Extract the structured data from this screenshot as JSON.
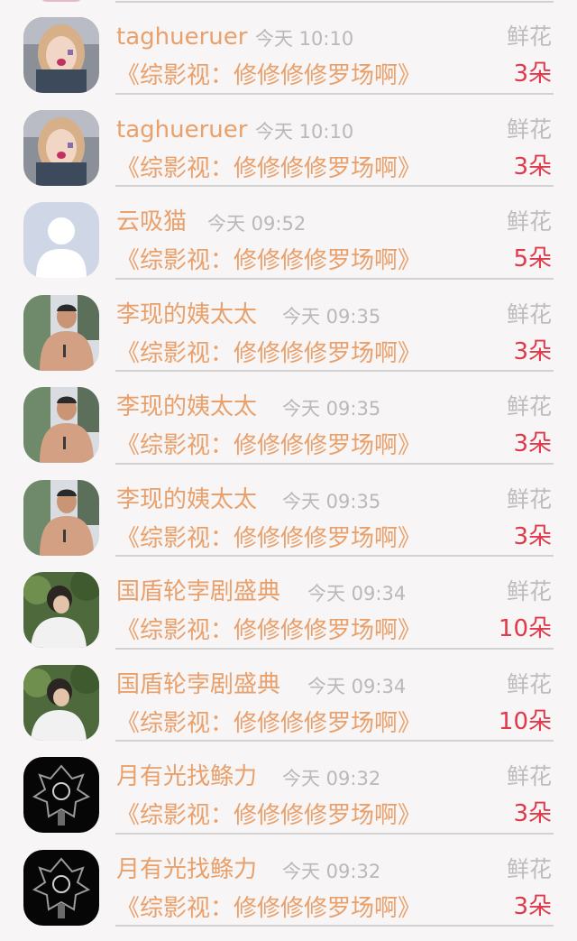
{
  "gift_type": "鲜花",
  "work_title": "《综影视：修修修修罗场啊》",
  "rows": [
    {
      "name": "taghueruer",
      "time": "今天 10:10",
      "count": "3朵",
      "avatar": "girl-avatar-icon"
    },
    {
      "name": "taghueruer",
      "time": "今天 10:10",
      "count": "3朵",
      "avatar": "girl-avatar-icon"
    },
    {
      "name": "云吸猫",
      "time": "今天 09:52",
      "count": "5朵",
      "avatar": "default-avatar-icon"
    },
    {
      "name": "李现的姨太太",
      "time": "今天 09:35",
      "count": "3朵",
      "avatar": "man-avatar-icon"
    },
    {
      "name": "李现的姨太太",
      "time": "今天 09:35",
      "count": "3朵",
      "avatar": "man-avatar-icon"
    },
    {
      "name": "李现的姨太太",
      "time": "今天 09:35",
      "count": "3朵",
      "avatar": "man-avatar-icon"
    },
    {
      "name": "国盾轮孛剧盛典",
      "time": "今天 09:34",
      "count": "10朵",
      "avatar": "boy-avatar-icon"
    },
    {
      "name": "国盾轮孛剧盛典",
      "time": "今天 09:34",
      "count": "10朵",
      "avatar": "boy-avatar-icon"
    },
    {
      "name": "月有光找鲦力",
      "time": "今天 09:32",
      "count": "3朵",
      "avatar": "dark-emblem-avatar-icon"
    },
    {
      "name": "月有光找鲦力",
      "time": "今天 09:32",
      "count": "3朵",
      "avatar": "dark-emblem-avatar-icon"
    }
  ]
}
